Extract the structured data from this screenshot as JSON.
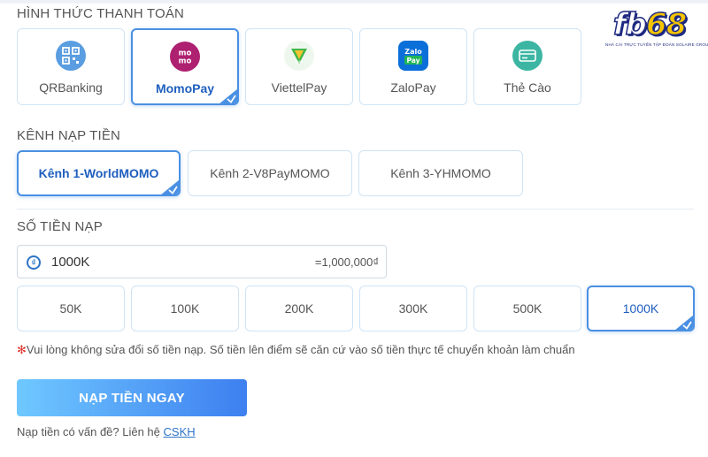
{
  "logo": {
    "text_main": "fb",
    "text_accent": "68",
    "tagline": "NHÀ CÁI TRỰC TUYẾN TẬP ĐOÀN SOLAIRE GROUP"
  },
  "payment_methods": {
    "title": "HÌNH THỨC THANH TOÁN",
    "items": [
      {
        "label": "QRBanking",
        "icon": "qr-icon",
        "color": "#5a9de0",
        "active": false
      },
      {
        "label": "MomoPay",
        "icon": "momo-icon",
        "color": "#ae2070",
        "active": true
      },
      {
        "label": "ViettelPay",
        "icon": "viettelpay-icon",
        "color": "#43b649",
        "active": false
      },
      {
        "label": "ZaloPay",
        "icon": "zalopay-icon",
        "color": "#0a6fd8",
        "active": false
      },
      {
        "label": "Thẻ Cào",
        "icon": "card-icon",
        "color": "#3cb6a3",
        "active": false
      }
    ]
  },
  "channels": {
    "title": "KÊNH NẠP TIỀN",
    "items": [
      {
        "label": "Kênh 1-WorldMOMO",
        "active": true
      },
      {
        "label": "Kênh 2-V8PayMOMO",
        "active": false
      },
      {
        "label": "Kênh 3-YHMOMO",
        "active": false
      }
    ]
  },
  "amount": {
    "title": "SỐ TIỀN NẠP",
    "value": "1000K",
    "converted": "=1,000,000₫",
    "presets": [
      {
        "label": "50K",
        "active": false
      },
      {
        "label": "100K",
        "active": false
      },
      {
        "label": "200K",
        "active": false
      },
      {
        "label": "300K",
        "active": false
      },
      {
        "label": "500K",
        "active": false
      },
      {
        "label": "1000K",
        "active": true
      }
    ]
  },
  "note": {
    "asterisk": "✻",
    "text": "Vui lòng không sửa đổi số tiền nạp. Số tiền lên điểm sẽ căn cứ vào số tiền thực tế chuyển khoản làm chuẩn"
  },
  "submit_label": "NẠP TIỀN NGAY",
  "help": {
    "text": "Nạp tiền có vấn đề? Liên hệ",
    "link": "CSKH"
  },
  "colors": {
    "accent": "#4a90e2",
    "border": "#cfe4f5",
    "warning": "#e0342c"
  }
}
